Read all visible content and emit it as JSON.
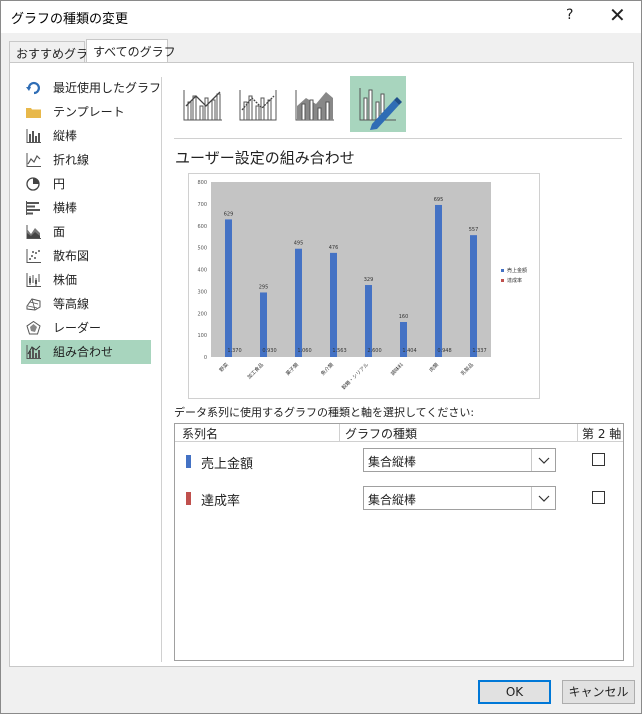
{
  "dialog": {
    "title": "グラフの種類の変更",
    "help": "?",
    "close": "✕"
  },
  "tabs": [
    {
      "label": "おすすめグラフ"
    },
    {
      "label": "すべてのグラフ"
    }
  ],
  "sidebar": {
    "items": [
      {
        "label": "最近使用したグラフ",
        "icon": "recent-icon"
      },
      {
        "label": "テンプレート",
        "icon": "folder-icon"
      },
      {
        "label": "縦棒",
        "icon": "column-chart-icon"
      },
      {
        "label": "折れ線",
        "icon": "line-chart-icon"
      },
      {
        "label": "円",
        "icon": "pie-chart-icon"
      },
      {
        "label": "横棒",
        "icon": "bar-chart-icon"
      },
      {
        "label": "面",
        "icon": "area-chart-icon"
      },
      {
        "label": "散布図",
        "icon": "scatter-chart-icon"
      },
      {
        "label": "株価",
        "icon": "stock-chart-icon"
      },
      {
        "label": "等高線",
        "icon": "surface-chart-icon"
      },
      {
        "label": "レーダー",
        "icon": "radar-chart-icon"
      },
      {
        "label": "組み合わせ",
        "icon": "combo-chart-icon"
      }
    ],
    "selected_index": 11
  },
  "combo_types": [
    {
      "icon": "clustered-column-line-icon"
    },
    {
      "icon": "clustered-column-line-secondary-axis-icon"
    },
    {
      "icon": "stacked-area-clustered-column-icon"
    },
    {
      "icon": "custom-combination-icon"
    }
  ],
  "section_title": "ユーザー設定の組み合わせ",
  "chart_data": {
    "type": "bar",
    "categories": [
      "野菜",
      "加工食品",
      "菓子類",
      "魚介類",
      "穀類・シリアル",
      "調味料",
      "肉類",
      "乳製品"
    ],
    "series": [
      {
        "name": "売上金額",
        "values": [
          629,
          295,
          495,
          476,
          329,
          160,
          695,
          557
        ],
        "color": "#4472c4"
      },
      {
        "name": "達成率",
        "values": [
          1.37,
          0.931,
          1.06,
          1.563,
          2.6,
          1.404,
          0.948,
          1.337
        ],
        "color": "#c0504d"
      }
    ],
    "bar_labels": [
      "629",
      "295",
      "495",
      "476",
      "329",
      "160",
      "695",
      "557"
    ],
    "rate_labels": [
      "1.370",
      "0.930",
      "1.060",
      "1.563",
      "2.600",
      "1.404",
      "0.948",
      "1.337"
    ],
    "y_ticks": [
      "800",
      "700",
      "600",
      "500",
      "400",
      "300",
      "200",
      "100",
      "0"
    ],
    "ylim": [
      0,
      800
    ],
    "legend_position": "right",
    "plot_background": "#c4c4c4"
  },
  "instruction": "データ系列に使用するグラフの種類と軸を選択してください:",
  "series_table": {
    "headers": {
      "name": "系列名",
      "type": "グラフの種類",
      "axis": "第 2 軸"
    },
    "rows": [
      {
        "name": "売上金額",
        "type": "集合縦棒",
        "secondary": false,
        "color": "#4472c4"
      },
      {
        "name": "達成率",
        "type": "集合縦棒",
        "secondary": false,
        "color": "#c0504d"
      }
    ]
  },
  "buttons": {
    "ok": "OK",
    "cancel": "キャンセル"
  }
}
